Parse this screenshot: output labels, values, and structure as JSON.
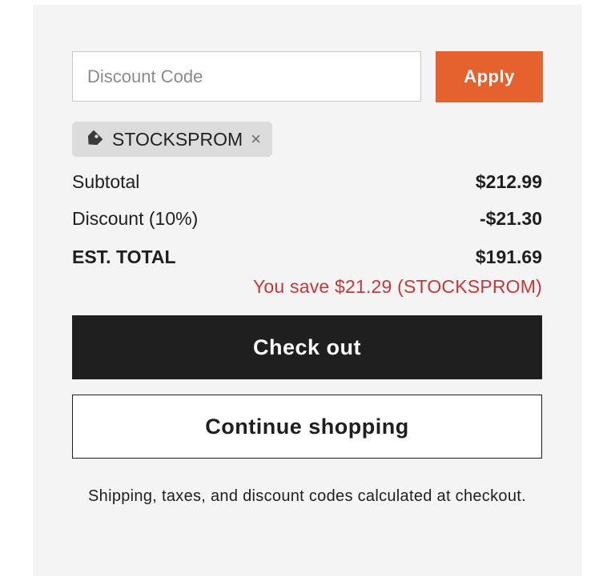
{
  "discount": {
    "placeholder": "Discount Code",
    "value": "",
    "apply_label": "Apply",
    "applied_code": "STOCKSPROM",
    "remove_glyph": "×",
    "tag_icon": "tag-icon",
    "remove_icon": "close-icon"
  },
  "summary": {
    "subtotal_label": "Subtotal",
    "subtotal_value": "$212.99",
    "discount_label": "Discount (10%)",
    "discount_value": "-$21.30",
    "total_label": "EST. TOTAL",
    "total_value": "$191.69",
    "savings_text": "You save $21.29 (STOCKSPROM)"
  },
  "actions": {
    "checkout_label": "Check out",
    "continue_label": "Continue shopping"
  },
  "footnote": "Shipping, taxes, and discount codes calculated at checkout.",
  "colors": {
    "panel_bg": "#f4f4f4",
    "apply_bg": "#e5612d",
    "checkout_bg": "#1f1f1f",
    "savings_text": "#c6373a",
    "chip_bg": "#dcdcdc"
  }
}
